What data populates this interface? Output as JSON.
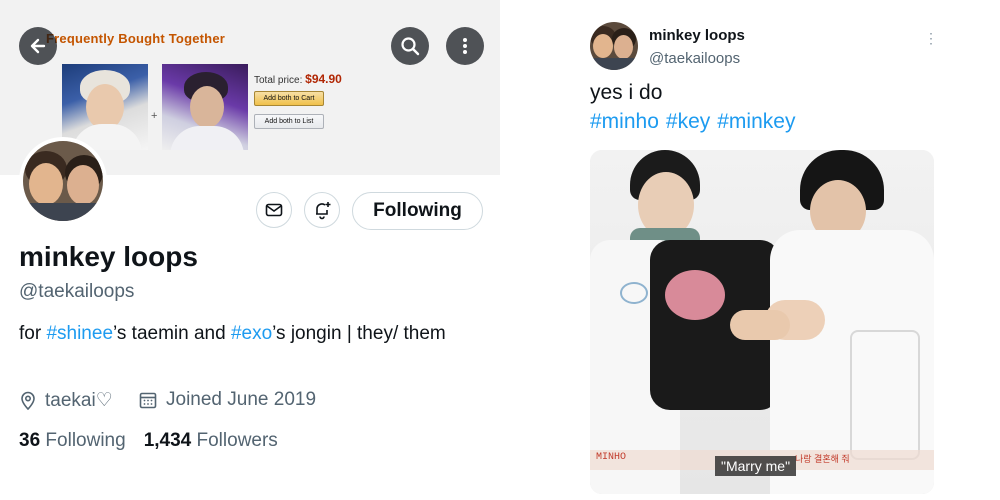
{
  "profile_screenshot": {
    "banner": {
      "title": "Frequently Bought Together",
      "total_label": "Total price:",
      "total_price": "$94.90",
      "plus": "+",
      "add_cart_label": "Add both to Cart",
      "add_list_label": "Add both to List"
    },
    "buttons": {
      "back_icon": "back-arrow-icon",
      "search_icon": "search-icon",
      "more_icon": "more-vertical-icon",
      "mail_icon": "mail-icon",
      "notify_icon": "bell-plus-icon",
      "following_label": "Following"
    },
    "name": "minkey loops",
    "handle": "@taekailoops",
    "bio": {
      "part1": "for ",
      "tag1": "#shinee",
      "part2": "’s taemin and ",
      "tag2": "#exo",
      "part3": "’s jongin | they/ them"
    },
    "location": "taekai♡",
    "joined": "Joined June 2019",
    "following_count": "36",
    "following_label": " Following",
    "followers_count": "1,434",
    "followers_label": " Followers"
  },
  "tweet": {
    "name": "minkey loops",
    "handle": "@taekailoops",
    "more": "⋮",
    "text": "yes i do",
    "hashtags": [
      "#minho",
      "#key",
      "#minkey"
    ],
    "photo": {
      "name_tag": "MINHO",
      "korean_caption": "나랑 결혼해 줘",
      "caption": "\"Marry me\""
    }
  },
  "colors": {
    "link": "#1d9bf0",
    "text": "#0f1419",
    "muted": "#536471",
    "price": "#b12704"
  }
}
